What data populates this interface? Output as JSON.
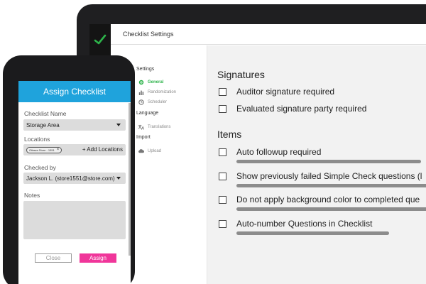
{
  "laptop": {
    "app_logo_icon": "checkmark-icon",
    "accent_color": "#2db34a",
    "header_title": "Checklist Settings",
    "nav": {
      "sections": [
        {
          "label": "Settings"
        },
        {
          "label": "Language"
        },
        {
          "label": "Import"
        }
      ],
      "items": [
        {
          "label": "General",
          "icon": "gear-icon",
          "active": true
        },
        {
          "label": "Randomization",
          "icon": "bar-chart-icon",
          "active": false
        },
        {
          "label": "Scheduler",
          "icon": "clock-icon",
          "active": false
        },
        {
          "label": "Translations",
          "icon": "translate-icon",
          "active": false
        },
        {
          "label": "Upload",
          "icon": "cloud-upload-icon",
          "active": false
        }
      ]
    },
    "signatures": {
      "title": "Signatures",
      "options": [
        {
          "label": "Auditor signature required",
          "checked": false
        },
        {
          "label": "Evaluated signature party required",
          "checked": false
        }
      ]
    },
    "items": {
      "title": "Items",
      "options": [
        {
          "label": "Auto followup required",
          "checked": false
        },
        {
          "label": "Show previously failed Simple Check questions (l",
          "checked": false
        },
        {
          "label": "Do not apply background color to completed que",
          "checked": false
        },
        {
          "label": "Auto-number Questions in Checklist",
          "checked": false
        }
      ]
    }
  },
  "phone": {
    "header_title": "Assign Checklist",
    "header_color": "#1fa3dc",
    "checklist_name": {
      "label": "Checklist Name",
      "value": "Storage Area"
    },
    "locations": {
      "label": "Locations",
      "chip": "Ottawa Store - 1551",
      "add_label": "+ Add Locations"
    },
    "checked_by": {
      "label": "Checked by",
      "value": "Jackson L. (store1551@store.com)"
    },
    "notes": {
      "label": "Notes",
      "value": ""
    },
    "close_label": "Close",
    "assign_label": "Assign",
    "assign_color": "#f0369a"
  }
}
